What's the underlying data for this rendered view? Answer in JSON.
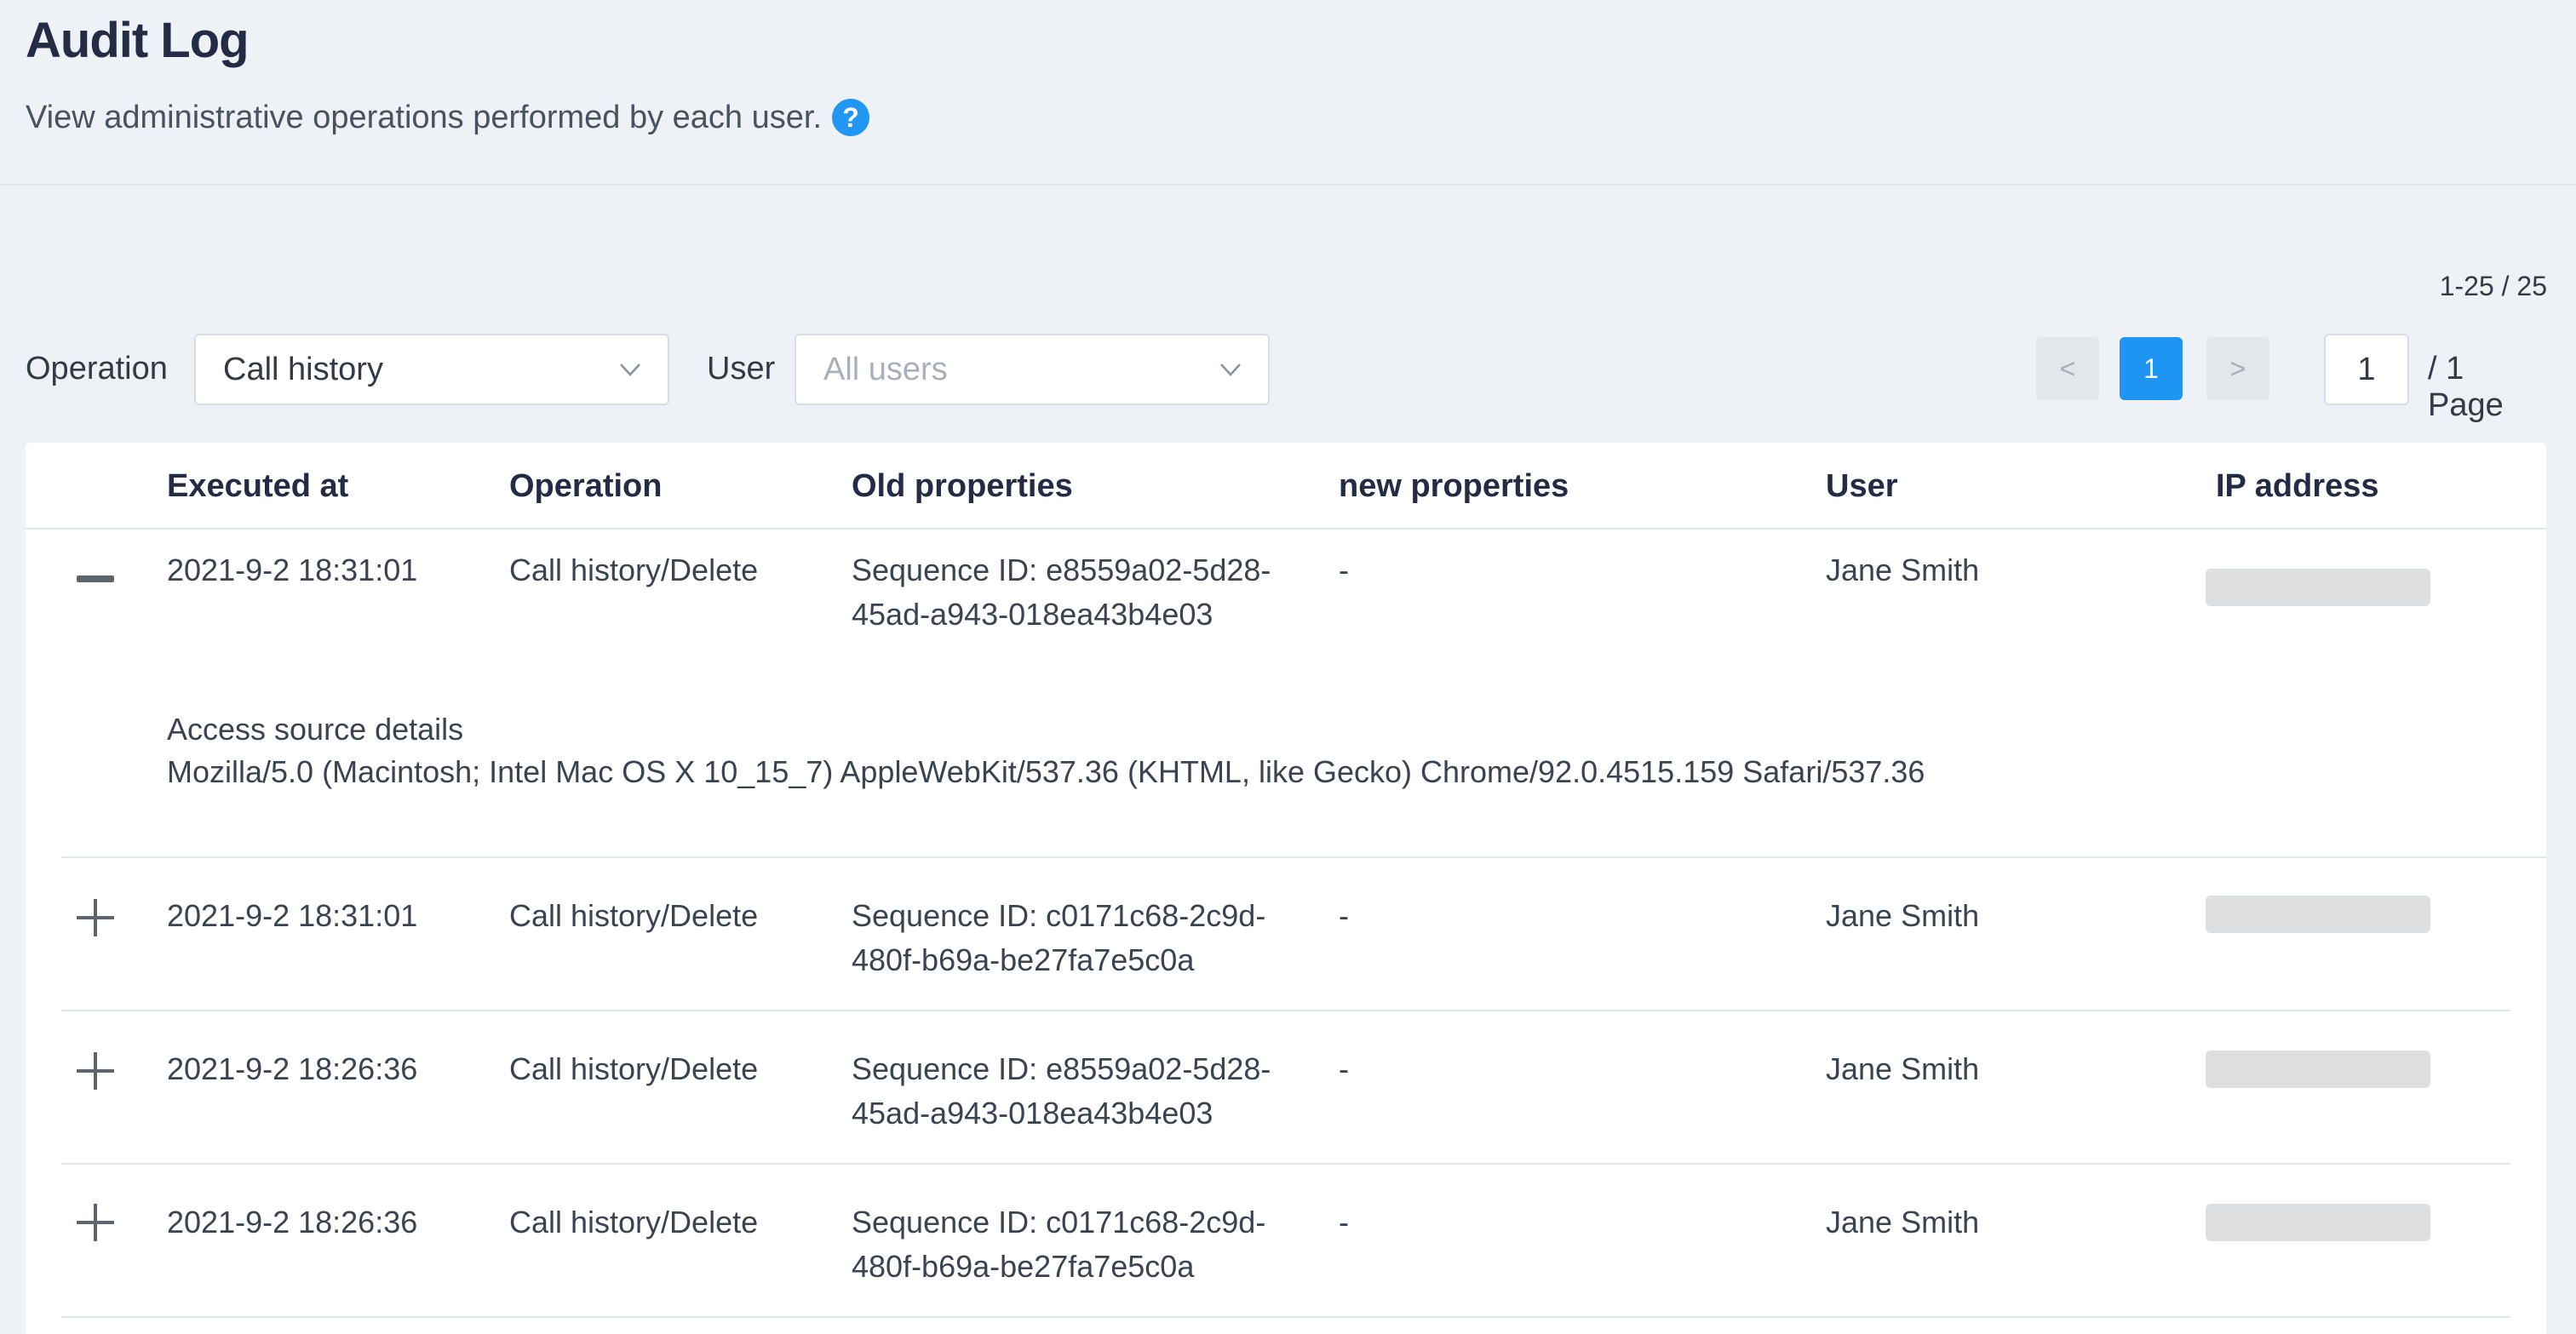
{
  "header": {
    "title": "Audit Log",
    "subtitle": "View administrative operations performed by each user.",
    "help_icon": "?"
  },
  "range": "1-25 / 25",
  "filters": {
    "operation_label": "Operation",
    "operation_value": "Call history",
    "user_label": "User",
    "user_placeholder": "All users"
  },
  "pagination": {
    "prev": "<",
    "current": "1",
    "next": ">",
    "page_input": "1",
    "total": "/ 1 Page"
  },
  "columns": [
    "Executed at",
    "Operation",
    "Old properties",
    "new properties",
    "User",
    "IP address"
  ],
  "rows": [
    {
      "expanded": true,
      "executed_at": "2021-9-2 18:31:01",
      "operation": "Call history/Delete",
      "old_line1": "Sequence ID: e8559a02-5d28-",
      "old_line2": "45ad-a943-018ea43b4e03",
      "new": "-",
      "user": "Jane Smith",
      "detail_label": "Access source details",
      "detail_value": "Mozilla/5.0 (Macintosh; Intel Mac OS X 10_15_7) AppleWebKit/537.36 (KHTML, like Gecko) Chrome/92.0.4515.159 Safari/537.36"
    },
    {
      "expanded": false,
      "executed_at": "2021-9-2 18:31:01",
      "operation": "Call history/Delete",
      "old_line1": "Sequence ID: c0171c68-2c9d-",
      "old_line2": "480f-b69a-be27fa7e5c0a",
      "new": "-",
      "user": "Jane Smith"
    },
    {
      "expanded": false,
      "executed_at": "2021-9-2 18:26:36",
      "operation": "Call history/Delete",
      "old_line1": "Sequence ID: e8559a02-5d28-",
      "old_line2": "45ad-a943-018ea43b4e03",
      "new": "-",
      "user": "Jane Smith"
    },
    {
      "expanded": false,
      "executed_at": "2021-9-2 18:26:36",
      "operation": "Call history/Delete",
      "old_line1": "Sequence ID: c0171c68-2c9d-",
      "old_line2": "480f-b69a-be27fa7e5c0a",
      "new": "-",
      "user": "Jane Smith"
    }
  ],
  "colors": {
    "accent": "#1e95f3",
    "title": "#262b45",
    "background": "#eef2f6"
  },
  "icons": {
    "help": "help-icon",
    "collapse": "minus-icon",
    "expand": "plus-icon",
    "dropdown": "chevron-down-icon"
  }
}
